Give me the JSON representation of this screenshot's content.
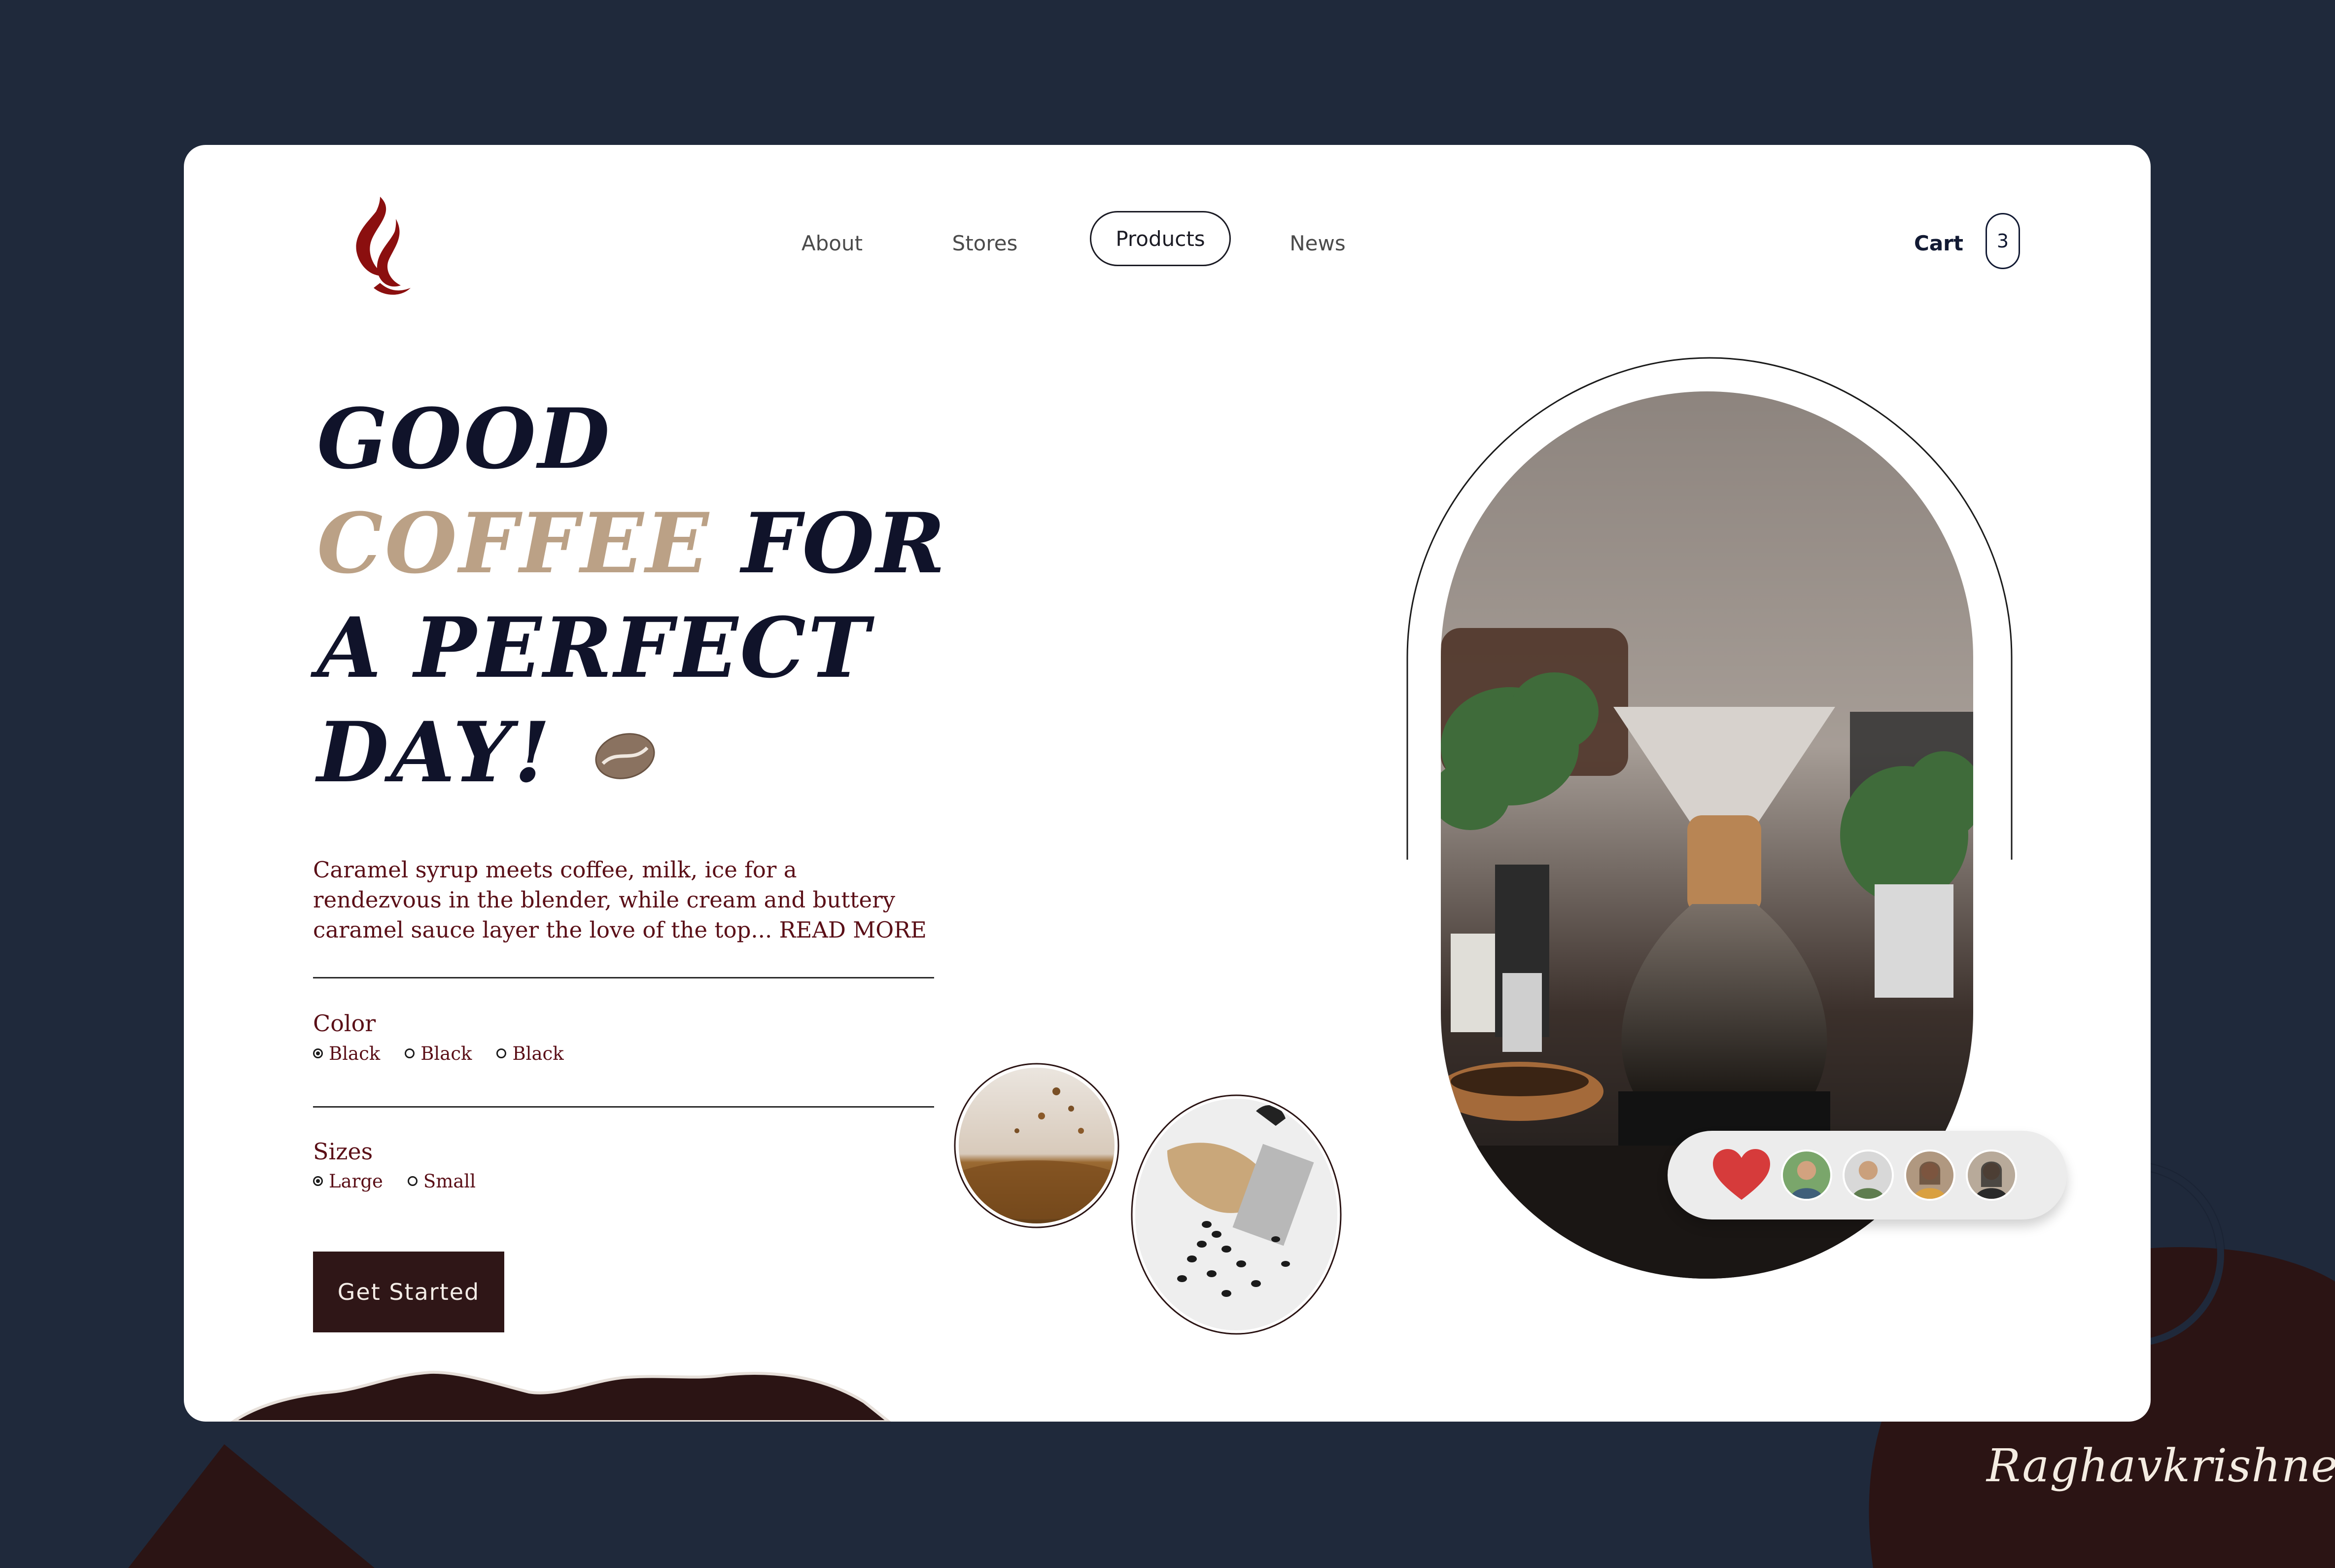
{
  "nav": {
    "items": [
      {
        "label": "About"
      },
      {
        "label": "Stores"
      },
      {
        "label": "Products"
      },
      {
        "label": "News"
      }
    ],
    "active": "Products",
    "cart_label": "Cart",
    "cart_count": "3"
  },
  "hero": {
    "line1": "GOOD",
    "line2_accent": "COFFEE",
    "line2_rest": " FOR",
    "line3": "A PERFECT",
    "line4": "DAY!",
    "description": "Caramel syrup meets coffee, milk, ice for a rendezvous in the blender, while cream and buttery caramel sauce layer the love of the top... READ MORE"
  },
  "options": {
    "color_title": "Color",
    "colors": [
      {
        "label": "Black",
        "selected": true
      },
      {
        "label": "Black",
        "selected": false
      },
      {
        "label": "Black",
        "selected": false
      }
    ],
    "size_title": "Sizes",
    "sizes": [
      {
        "label": "Large",
        "selected": true
      },
      {
        "label": "Small",
        "selected": false
      }
    ]
  },
  "cta_label": "Get Started",
  "signature": "Raghavkrishnet",
  "colors": {
    "background": "#1f293b",
    "card": "#ffffff",
    "brand_red": "#8b0f0f",
    "accent_beige": "#bba186",
    "headline": "#10132a",
    "body_text": "#5a0f17",
    "button": "#2f1617",
    "decor_brown": "#2b1414"
  },
  "icons": [
    "flame-logo-icon",
    "coffee-bean-icon",
    "heart-icon"
  ]
}
